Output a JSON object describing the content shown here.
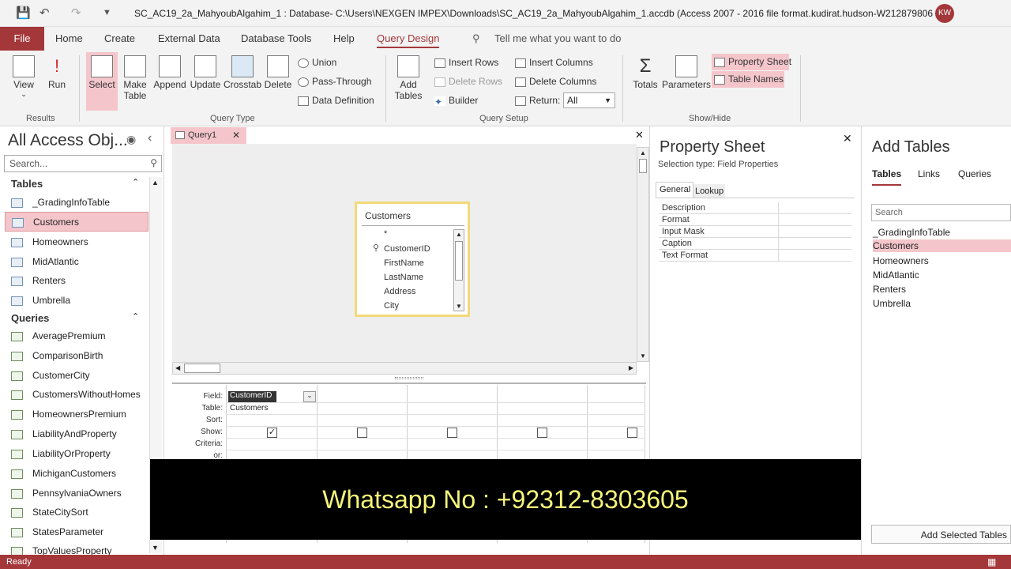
{
  "titlebar": {
    "title": "SC_AC19_2a_MahyoubAlgahim_1 : Database- C:\\Users\\NEXGEN IMPEX\\Downloads\\SC_AC19_2a_MahyoubAlgahim_1.accdb (Access 2007 - 2016 file format...",
    "user": "kudirat.hudson-W212879806",
    "avatar": "KW"
  },
  "tabs": [
    "File",
    "Home",
    "Create",
    "External Data",
    "Database Tools",
    "Help",
    "Query Design"
  ],
  "tell_me": "Tell me what you want to do",
  "ribbon": {
    "results": {
      "view": "View",
      "run": "Run",
      "group": "Results"
    },
    "query_type": {
      "select": "Select",
      "make_table_1": "Make",
      "make_table_2": "Table",
      "append": "Append",
      "update": "Update",
      "crosstab": "Crosstab",
      "delete": "Delete",
      "union": "Union",
      "pass_through": "Pass-Through",
      "data_definition": "Data Definition",
      "group": "Query Type"
    },
    "query_setup": {
      "add_tables_1": "Add",
      "add_tables_2": "Tables",
      "insert_rows": "Insert Rows",
      "delete_rows": "Delete Rows",
      "builder": "Builder",
      "insert_columns": "Insert Columns",
      "delete_columns": "Delete Columns",
      "return_label": "Return:",
      "return_value": "All",
      "group": "Query Setup"
    },
    "show_hide": {
      "totals": "Totals",
      "parameters": "Parameters",
      "property_sheet": "Property Sheet",
      "table_names": "Table Names",
      "group": "Show/Hide"
    }
  },
  "nav": {
    "title": "All Access Obj...",
    "search_placeholder": "Search...",
    "tables_header": "Tables",
    "tables": [
      "_GradingInfoTable",
      "Customers",
      "Homeowners",
      "MidAtlantic",
      "Renters",
      "Umbrella"
    ],
    "queries_header": "Queries",
    "queries": [
      "AveragePremium",
      "ComparisonBirth",
      "CustomerCity",
      "CustomersWithoutHomes",
      "HomeownersPremium",
      "LiabilityAndProperty",
      "LiabilityOrProperty",
      "MichiganCustomers",
      "PennsylvaniaOwners",
      "StateCitySort",
      "StatesParameter",
      "TopValuesProperty"
    ]
  },
  "doc": {
    "tab": "Query1",
    "table_title": "Customers",
    "fields": [
      "*",
      "CustomerID",
      "FirstName",
      "LastName",
      "Address",
      "City"
    ],
    "qbe_labels": [
      "Field:",
      "Table:",
      "Sort:",
      "Show:",
      "Criteria:",
      "or:"
    ],
    "field1": "CustomerID",
    "table1": "Customers"
  },
  "property_sheet": {
    "title": "Property Sheet",
    "selection_type": "Selection type:  Field Properties",
    "tab_general": "General",
    "tab_lookup": "Lookup",
    "rows": [
      "Description",
      "Format",
      "Input Mask",
      "Caption",
      "Text Format"
    ]
  },
  "add_tables": {
    "title": "Add Tables",
    "tabs": [
      "Tables",
      "Links",
      "Queries"
    ],
    "search_placeholder": "Search",
    "items": [
      "_GradingInfoTable",
      "Customers",
      "Homeowners",
      "MidAtlantic",
      "Renters",
      "Umbrella"
    ],
    "button": "Add Selected Tables"
  },
  "status": "Ready",
  "banner": "Whatsapp No : +92312-8303605",
  "colors": {
    "accent": "#a4373a",
    "selection": "#f4c6cb",
    "banner_text": "#f5f57a"
  }
}
